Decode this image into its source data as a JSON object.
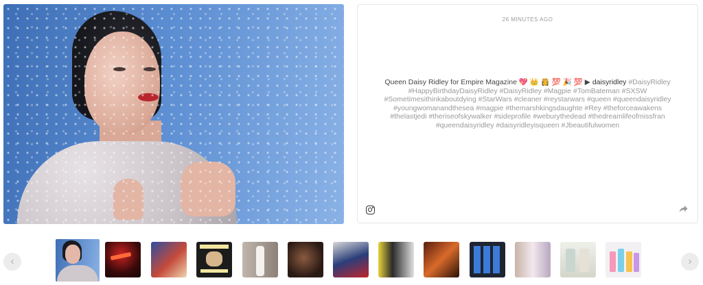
{
  "post": {
    "time_ago": "26 MINUTES AGO",
    "caption_lead": "Queen Daisy Ridley for Empire Magazine 💖 👑 👸 💯 🎉 💯 ▶",
    "author": "daisyridley",
    "hashtags": "#DaisyRidley #HappyBirthdayDaisyRidley #DaisyRidley #Magpie #TomBateman #SXSW #Sometimesithinkaboutdying #StarWars #cleaner #reystarwars #queen #queendaisyridley #youngwomanandthesea #magpie #themarshkingsdaughte #Rey #theforceawakens #thelastjedi #theriseofskywalker #sideprofile #weburythedead #thedreamlifeofmissfran #queendaisyridley #daisyridleyisqueen #Jbeautifulwomen"
  },
  "icons": {
    "instagram": "instagram-icon",
    "share": "share-arrow-icon",
    "prev": "chevron-left-icon",
    "next": "chevron-right-icon"
  },
  "navigation": {
    "prev_glyph": "‹",
    "next_glyph": "›"
  },
  "thumbnails": [
    {
      "subject": "woman-wet-glass-portrait",
      "active": true
    },
    {
      "subject": "neon-sign"
    },
    {
      "subject": "sports-action"
    },
    {
      "subject": "book-poster"
    },
    {
      "subject": "person-standing"
    },
    {
      "subject": "dark-portrait"
    },
    {
      "subject": "hockey-player"
    },
    {
      "subject": "premiere-couple"
    },
    {
      "subject": "guitar-player"
    },
    {
      "subject": "phone-app-grid"
    },
    {
      "subject": "tumblers"
    },
    {
      "subject": "tumblers-white"
    },
    {
      "subject": "tumblers-pastel"
    }
  ],
  "colors": {
    "accent_text": "#333333",
    "muted_text": "#9a9a9a"
  }
}
